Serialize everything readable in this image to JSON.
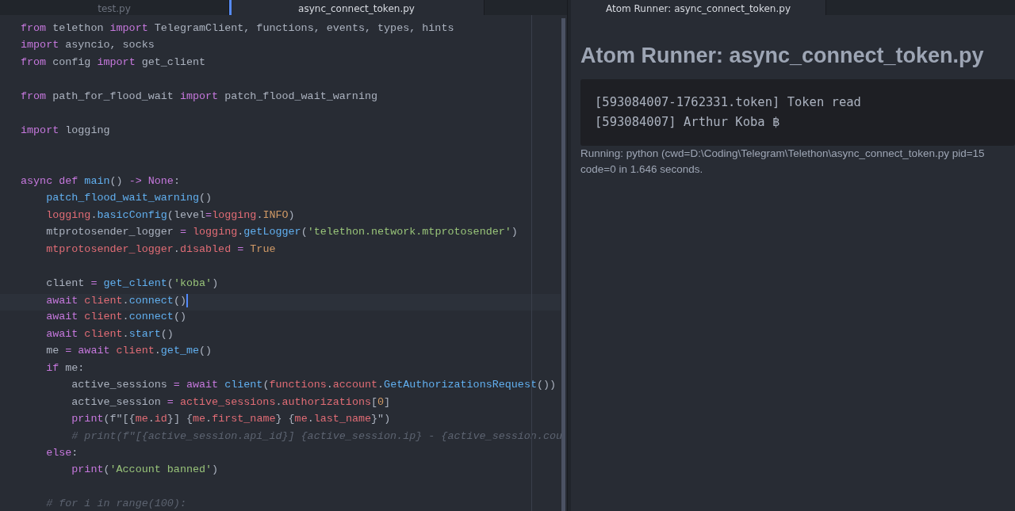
{
  "editor": {
    "tabs": [
      {
        "label": "test.py",
        "selected": false
      },
      {
        "label": "async_connect_token.py",
        "selected": true
      }
    ],
    "lines": [
      {
        "current": false,
        "tokens": [
          {
            "kind": "kw",
            "t": "from"
          },
          {
            "kind": "plain",
            "t": " telethon "
          },
          {
            "kind": "kw",
            "t": "import"
          },
          {
            "kind": "plain",
            "t": " TelegramClient, functions, events, types, hints"
          }
        ]
      },
      {
        "current": false,
        "tokens": [
          {
            "kind": "kw",
            "t": "import"
          },
          {
            "kind": "plain",
            "t": " asyncio, socks"
          }
        ]
      },
      {
        "current": false,
        "tokens": [
          {
            "kind": "kw",
            "t": "from"
          },
          {
            "kind": "plain",
            "t": " config "
          },
          {
            "kind": "kw",
            "t": "import"
          },
          {
            "kind": "plain",
            "t": " get_client"
          }
        ]
      },
      {
        "current": false
      },
      {
        "current": false,
        "tokens": [
          {
            "kind": "kw",
            "t": "from"
          },
          {
            "kind": "plain",
            "t": " path_for_flood_wait "
          },
          {
            "kind": "kw",
            "t": "import"
          },
          {
            "kind": "plain",
            "t": " patch_flood_wait_warning"
          }
        ]
      },
      {
        "current": false
      },
      {
        "current": false,
        "tokens": [
          {
            "kind": "kw",
            "t": "import"
          },
          {
            "kind": "plain",
            "t": " logging"
          }
        ]
      },
      {
        "current": false
      },
      {
        "current": false
      },
      {
        "current": false,
        "tokens": [
          {
            "kind": "kw",
            "t": "async def "
          },
          {
            "kind": "fn",
            "t": "main"
          },
          {
            "kind": "plain",
            "t": "() "
          },
          {
            "kind": "kw",
            "t": "-> None"
          },
          {
            "kind": "plain",
            "t": ":"
          }
        ]
      },
      {
        "current": false,
        "tokens": [
          {
            "kind": "fn",
            "t": "    patch_flood_wait_warning"
          },
          {
            "kind": "plain",
            "t": "()"
          }
        ]
      },
      {
        "current": false,
        "tokens": [
          {
            "kind": "var",
            "t": "    logging"
          },
          {
            "kind": "plain",
            "t": "."
          },
          {
            "kind": "fn",
            "t": "basicConfig"
          },
          {
            "kind": "plain",
            "t": "(level"
          },
          {
            "kind": "kw",
            "t": "="
          },
          {
            "kind": "var",
            "t": "logging"
          },
          {
            "kind": "plain",
            "t": "."
          },
          {
            "kind": "num",
            "t": "INFO"
          },
          {
            "kind": "plain",
            "t": ")"
          }
        ]
      },
      {
        "current": false,
        "tokens": [
          {
            "kind": "plain",
            "t": "    mtprotosender_logger "
          },
          {
            "kind": "kw",
            "t": "="
          },
          {
            "kind": "var",
            "t": " logging"
          },
          {
            "kind": "plain",
            "t": "."
          },
          {
            "kind": "fn",
            "t": "getLogger"
          },
          {
            "kind": "plain",
            "t": "("
          },
          {
            "kind": "str",
            "t": "'telethon.network.mtprotosender'"
          },
          {
            "kind": "plain",
            "t": ")"
          }
        ]
      },
      {
        "current": false,
        "tokens": [
          {
            "kind": "var",
            "t": "    mtprotosender_logger"
          },
          {
            "kind": "plain",
            "t": "."
          },
          {
            "kind": "var",
            "t": "disabled"
          },
          {
            "kind": "kw",
            "t": " = "
          },
          {
            "kind": "num",
            "t": "True"
          }
        ]
      },
      {
        "current": false
      },
      {
        "current": false,
        "tokens": [
          {
            "kind": "plain",
            "t": "    client "
          },
          {
            "kind": "kw",
            "t": "="
          },
          {
            "kind": "fn",
            "t": " get_client"
          },
          {
            "kind": "plain",
            "t": "("
          },
          {
            "kind": "str",
            "t": "'koba'"
          },
          {
            "kind": "plain",
            "t": ")"
          }
        ]
      },
      {
        "current": true,
        "tokens": [
          {
            "kind": "kw",
            "t": "    await "
          },
          {
            "kind": "var",
            "t": "client"
          },
          {
            "kind": "plain",
            "t": "."
          },
          {
            "kind": "fn",
            "t": "connect"
          },
          {
            "kind": "plain",
            "t": "()"
          }
        ]
      },
      {
        "current": false,
        "tokens": [
          {
            "kind": "kw",
            "t": "    await "
          },
          {
            "kind": "var",
            "t": "client"
          },
          {
            "kind": "plain",
            "t": "."
          },
          {
            "kind": "fn",
            "t": "connect"
          },
          {
            "kind": "plain",
            "t": "()"
          }
        ]
      },
      {
        "current": false,
        "tokens": [
          {
            "kind": "kw",
            "t": "    await "
          },
          {
            "kind": "var",
            "t": "client"
          },
          {
            "kind": "plain",
            "t": "."
          },
          {
            "kind": "fn",
            "t": "start"
          },
          {
            "kind": "plain",
            "t": "()"
          }
        ]
      },
      {
        "current": false,
        "tokens": [
          {
            "kind": "plain",
            "t": "    me "
          },
          {
            "kind": "kw",
            "t": "= await "
          },
          {
            "kind": "var",
            "t": "client"
          },
          {
            "kind": "plain",
            "t": "."
          },
          {
            "kind": "fn",
            "t": "get_me"
          },
          {
            "kind": "plain",
            "t": "()"
          }
        ]
      },
      {
        "current": false,
        "tokens": [
          {
            "kind": "kw",
            "t": "    if"
          },
          {
            "kind": "plain",
            "t": " me:"
          }
        ]
      },
      {
        "current": false,
        "tokens": [
          {
            "kind": "plain",
            "t": "        active_sessions "
          },
          {
            "kind": "kw",
            "t": "= await "
          },
          {
            "kind": "fn",
            "t": "client"
          },
          {
            "kind": "plain",
            "t": "("
          },
          {
            "kind": "var",
            "t": "functions"
          },
          {
            "kind": "plain",
            "t": "."
          },
          {
            "kind": "var",
            "t": "account"
          },
          {
            "kind": "plain",
            "t": "."
          },
          {
            "kind": "fn",
            "t": "GetAuthorizationsRequest"
          },
          {
            "kind": "plain",
            "t": "())"
          }
        ]
      },
      {
        "current": false,
        "tokens": [
          {
            "kind": "plain",
            "t": "        active_session "
          },
          {
            "kind": "kw",
            "t": "="
          },
          {
            "kind": "var",
            "t": " active_sessions"
          },
          {
            "kind": "plain",
            "t": "."
          },
          {
            "kind": "var",
            "t": "authorizations"
          },
          {
            "kind": "plain",
            "t": "["
          },
          {
            "kind": "num",
            "t": "0"
          },
          {
            "kind": "plain",
            "t": "]"
          }
        ]
      },
      {
        "current": false,
        "tokens": [
          {
            "kind": "kw",
            "t": "        print"
          },
          {
            "kind": "plain",
            "t": "(f\"[{"
          },
          {
            "kind": "var",
            "t": "me"
          },
          {
            "kind": "plain",
            "t": "."
          },
          {
            "kind": "var",
            "t": "id"
          },
          {
            "kind": "plain",
            "t": "}] {"
          },
          {
            "kind": "var",
            "t": "me"
          },
          {
            "kind": "plain",
            "t": "."
          },
          {
            "kind": "var",
            "t": "first_name"
          },
          {
            "kind": "plain",
            "t": "} {"
          },
          {
            "kind": "var",
            "t": "me"
          },
          {
            "kind": "plain",
            "t": "."
          },
          {
            "kind": "var",
            "t": "last_name"
          },
          {
            "kind": "plain",
            "t": "}\")"
          }
        ]
      },
      {
        "current": false,
        "tokens": [
          {
            "kind": "comment",
            "t": "        # print(f\"[{active_session.api_id}] {active_session.ip} - {active_session.cou"
          }
        ]
      },
      {
        "current": false,
        "tokens": [
          {
            "kind": "kw",
            "t": "    else"
          },
          {
            "kind": "plain",
            "t": ":"
          }
        ]
      },
      {
        "current": false,
        "tokens": [
          {
            "kind": "kw",
            "t": "        print"
          },
          {
            "kind": "plain",
            "t": "("
          },
          {
            "kind": "str",
            "t": "'Account banned'"
          },
          {
            "kind": "plain",
            "t": ")"
          }
        ]
      },
      {
        "current": false
      },
      {
        "current": false,
        "tokens": [
          {
            "kind": "comment",
            "t": "    # for i in range(100):"
          }
        ]
      }
    ]
  },
  "runner": {
    "tab": {
      "label": "Atom Runner: async_connect_token.py",
      "selected": true
    },
    "title": "Atom Runner: async_connect_token.py",
    "output": [
      "[593084007-1762331.token] Token read",
      "[593084007] Arthur Koba ฿"
    ],
    "status": [
      "Running: python (cwd=D:\\Coding\\Telegram\\Telethon\\async_connect_token.py pid=15",
      "code=0 in 1.646 seconds."
    ]
  }
}
